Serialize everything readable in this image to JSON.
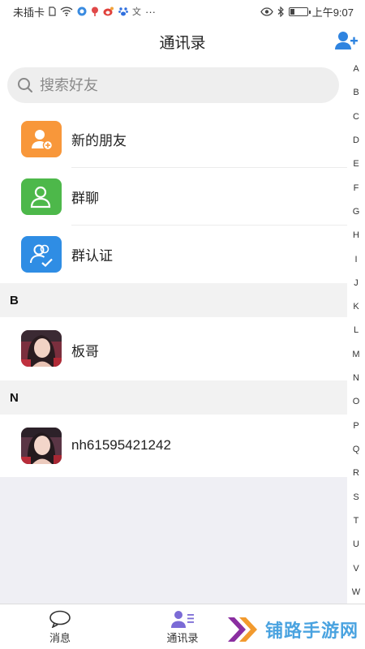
{
  "status_bar": {
    "carrier": "未插卡",
    "time": "上午9:07",
    "more": "···",
    "battery_level": 0.25,
    "icons": [
      "sim-icon",
      "wifi-icon",
      "app-icon",
      "pin-icon",
      "weibo-icon",
      "baidu-icon",
      "translate-icon",
      "eye-icon",
      "bluetooth-icon",
      "battery-icon"
    ]
  },
  "header": {
    "title": "通讯录",
    "add_icon": "add-friend-icon"
  },
  "search": {
    "placeholder": "搜索好友"
  },
  "quick_items": [
    {
      "label": "新的朋友",
      "color": "#f8973a",
      "icon": "new-friend-icon"
    },
    {
      "label": "群聊",
      "color": "#4db84a",
      "icon": "group-chat-icon"
    },
    {
      "label": "群认证",
      "color": "#2f8de4",
      "icon": "group-verify-icon"
    }
  ],
  "sections": [
    {
      "letter": "B",
      "contacts": [
        {
          "name": "板哥"
        }
      ]
    },
    {
      "letter": "N",
      "contacts": [
        {
          "name": "nh61595421242"
        }
      ]
    }
  ],
  "alphabet": [
    "A",
    "B",
    "C",
    "D",
    "E",
    "F",
    "G",
    "H",
    "I",
    "J",
    "K",
    "L",
    "M",
    "N",
    "O",
    "P",
    "Q",
    "R",
    "S",
    "T",
    "U",
    "V",
    "W"
  ],
  "bottom_nav": {
    "messages": "消息",
    "contacts": "通讯录",
    "active_color": "#7b6bd6"
  },
  "watermark": {
    "text": "铺路手游网"
  }
}
